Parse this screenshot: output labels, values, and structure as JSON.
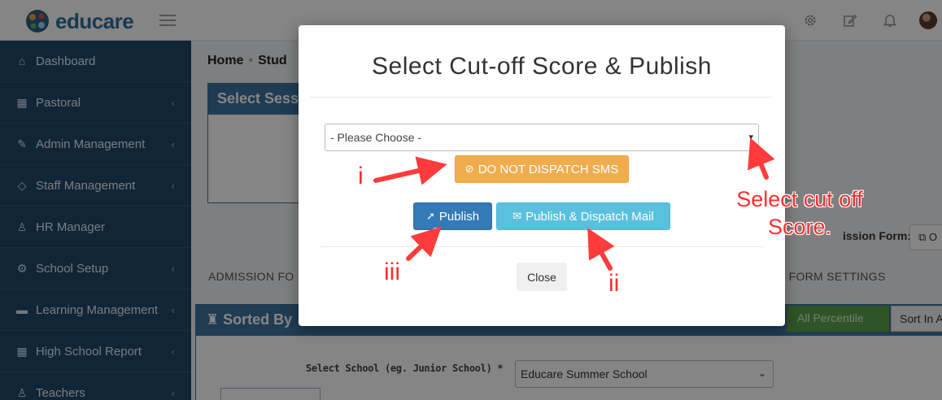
{
  "header": {
    "logo_text": "educare",
    "icons": [
      "gear-icon",
      "edit-icon",
      "bell-icon",
      "avatar"
    ]
  },
  "sidebar": {
    "items": [
      {
        "label": "Dashboard",
        "icon": "home-icon",
        "has_children": false
      },
      {
        "label": "Pastoral",
        "icon": "table-icon",
        "has_children": true
      },
      {
        "label": "Admin Management",
        "icon": "wrench-icon",
        "has_children": true
      },
      {
        "label": "Staff Management",
        "icon": "diamond-icon",
        "has_children": true
      },
      {
        "label": "HR Manager",
        "icon": "user-icon",
        "has_children": false
      },
      {
        "label": "School Setup",
        "icon": "gear-icon",
        "has_children": true
      },
      {
        "label": "Learning Management",
        "icon": "folder-icon",
        "has_children": true
      },
      {
        "label": "High School Report",
        "icon": "table-icon",
        "has_children": true
      },
      {
        "label": "Teachers",
        "icon": "user-icon",
        "has_children": true
      }
    ]
  },
  "main": {
    "breadcrumb": {
      "home": "Home",
      "current": "Stud"
    },
    "panel1_title": "Select Sess",
    "admission_form_label": "ission Form:",
    "admission_form_button": "O",
    "tab_admission": "ADMISSION FO",
    "tab_form_settings": "N FORM SETTINGS",
    "panel2_title": "Sorted By",
    "percentile_button": "All Percentile",
    "sort_button": "Sort In A",
    "school_label": "Select School (eg. Junior School) *",
    "school_select_value": "Educare Summer School"
  },
  "modal": {
    "title": "Select Cut-off Score & Publish",
    "select_value": "- Please Choose -",
    "dispatch_sms_button": "DO NOT DISPATCH SMS",
    "publish_button": "Publish",
    "publish_mail_button": "Publish & Dispatch Mail",
    "close_button": "Close"
  },
  "annotations": {
    "i": "i",
    "ii": "ii",
    "iii": "iii",
    "cut_off_note": "Select cut off Score.",
    "color": "#ff2e2e"
  }
}
